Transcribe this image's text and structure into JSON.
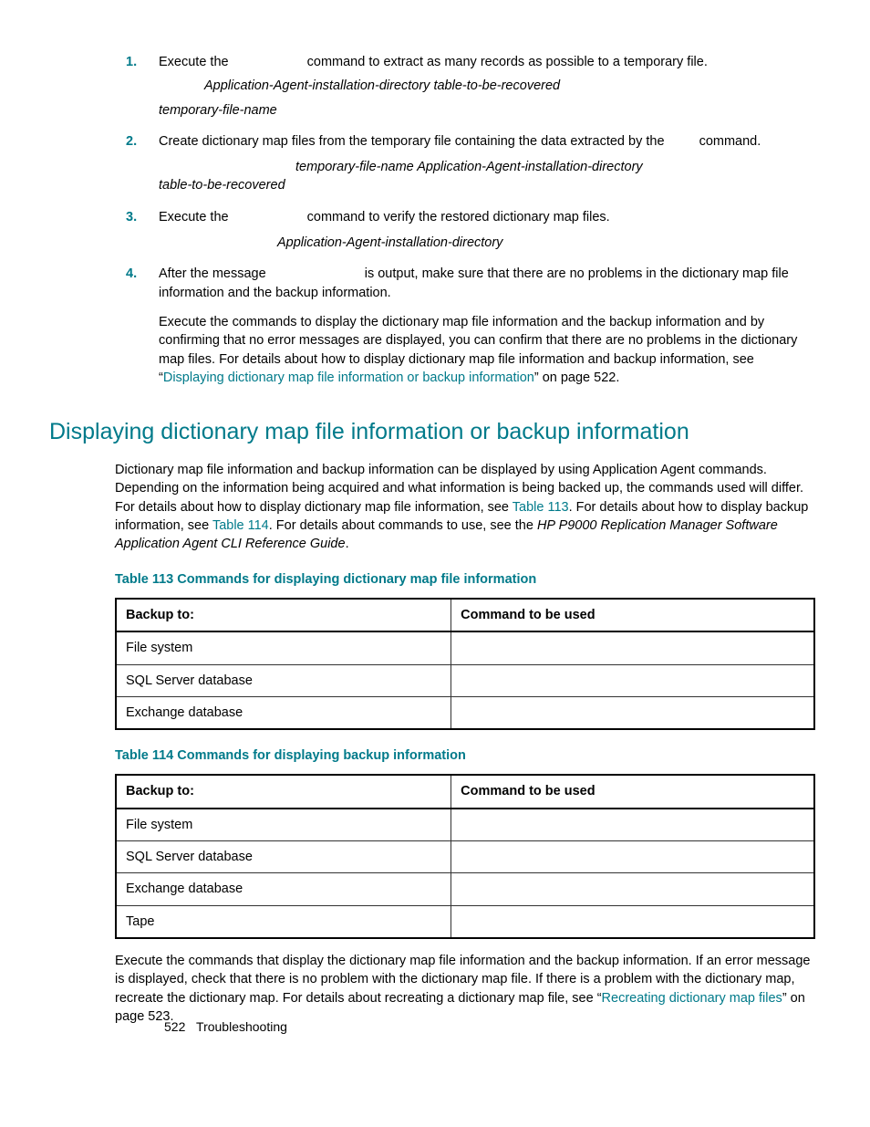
{
  "steps": [
    {
      "num": "1.",
      "pre": "Execute the ",
      "mid": " command to extract as many records as possible to a temporary file.",
      "italic_line": "Application-Agent-installation-directory                table-to-be-recovered",
      "italic_line2": "temporary-file-name"
    },
    {
      "num": "2.",
      "body_a": "Create dictionary map files from the temporary file containing the data extracted by the ",
      "body_b": " command.",
      "italic_line": "temporary-file-name Application-Agent-installation-directory",
      "italic_line2": "table-to-be-recovered"
    },
    {
      "num": "3.",
      "pre": "Execute the ",
      "mid": " command to verify the restored dictionary map files.",
      "italic_line_center": "Application-Agent-installation-directory"
    },
    {
      "num": "4.",
      "pre": "After the message ",
      "mid": " is output, make sure that there are no problems in the dictionary map file information and the backup information.",
      "para2_a": "Execute the commands to display the dictionary map file information and the backup information and by confirming that no error messages are displayed, you can confirm that there are no problems in the dictionary map files. For details about how to display dictionary map file information and backup information, see “",
      "para2_link": "Displaying dictionary map file information or backup information",
      "para2_b": "” on page 522."
    }
  ],
  "section_title": "Displaying dictionary map file information or backup information",
  "intro_a": "Dictionary map file information and backup information can be displayed by using Application Agent commands. Depending on the information being acquired and what information is being backed up, the commands used will differ. For details about how to display dictionary map file information, see ",
  "intro_link1": "Table 113",
  "intro_b": ". For details about how to display backup information, see ",
  "intro_link2": "Table 114",
  "intro_c": ". For details about commands to use, see the ",
  "intro_italic": "HP P9000 Replication Manager Software Application Agent CLI Reference Guide",
  "intro_d": ".",
  "table113_title": "Table 113 Commands for displaying dictionary map file information",
  "table114_title": "Table 114 Commands for displaying backup information",
  "th_backup": "Backup to:",
  "th_cmd": "Command to be used",
  "t113": {
    "rows": [
      {
        "a": "File system",
        "b": ""
      },
      {
        "a": "SQL Server database",
        "b": ""
      },
      {
        "a": "Exchange database",
        "b": ""
      }
    ]
  },
  "t114": {
    "rows": [
      {
        "a": "File system",
        "b": ""
      },
      {
        "a": "SQL Server database",
        "b": ""
      },
      {
        "a": "Exchange database",
        "b": ""
      },
      {
        "a": "Tape",
        "b": ""
      }
    ]
  },
  "outro_a": "Execute the commands that display the dictionary map file information and the backup information. If an error message is displayed, check that there is no problem with the dictionary map file. If there is a problem with the dictionary map, recreate the dictionary map. For details about recreating a dictionary map file, see “",
  "outro_link": "Recreating dictionary map files",
  "outro_b": "” on page 523.",
  "footer_page": "522",
  "footer_label": "Troubleshooting"
}
